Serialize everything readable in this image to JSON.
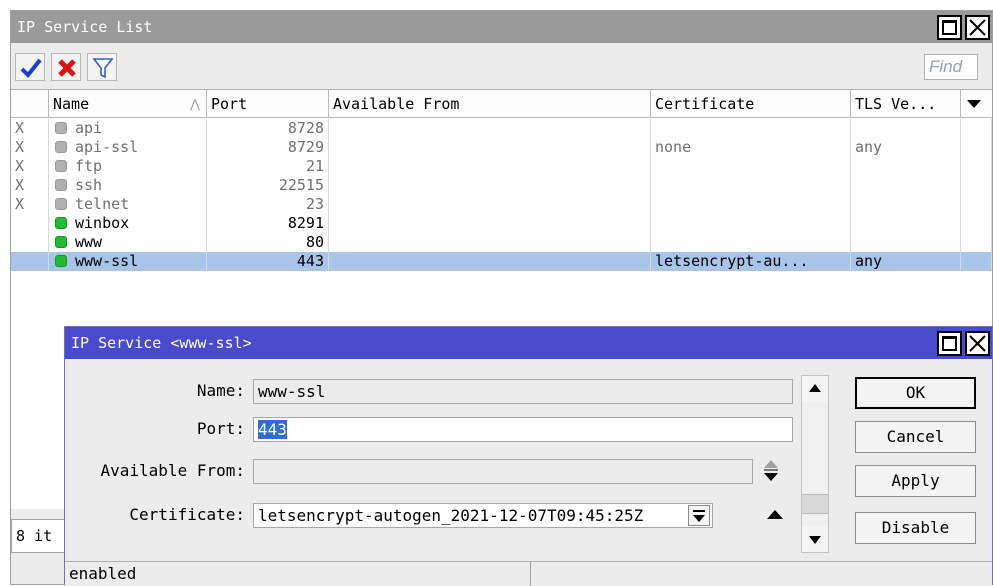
{
  "list_window": {
    "title": "IP Service List",
    "find_placeholder": "Find",
    "columns": [
      "Name",
      "Port",
      "Available From",
      "Certificate",
      "TLS Ve..."
    ],
    "rows": [
      {
        "flag": "X",
        "name": "api",
        "port": "8728",
        "available_from": "",
        "certificate": "",
        "tls": "",
        "status": "disabled"
      },
      {
        "flag": "X",
        "name": "api-ssl",
        "port": "8729",
        "available_from": "",
        "certificate": "none",
        "tls": "any",
        "status": "disabled"
      },
      {
        "flag": "X",
        "name": "ftp",
        "port": "21",
        "available_from": "",
        "certificate": "",
        "tls": "",
        "status": "disabled"
      },
      {
        "flag": "X",
        "name": "ssh",
        "port": "22515",
        "available_from": "",
        "certificate": "",
        "tls": "",
        "status": "disabled"
      },
      {
        "flag": "X",
        "name": "telnet",
        "port": "23",
        "available_from": "",
        "certificate": "",
        "tls": "",
        "status": "disabled"
      },
      {
        "flag": "",
        "name": "winbox",
        "port": "8291",
        "available_from": "",
        "certificate": "",
        "tls": "",
        "status": "enabled"
      },
      {
        "flag": "",
        "name": "www",
        "port": "80",
        "available_from": "",
        "certificate": "",
        "tls": "",
        "status": "enabled"
      },
      {
        "flag": "",
        "name": "www-ssl",
        "port": "443",
        "available_from": "",
        "certificate": "letsencrypt-au...",
        "tls": "any",
        "status": "enabled",
        "selected": true
      }
    ],
    "item_count": "8 it"
  },
  "detail_window": {
    "title": "IP Service <www-ssl>",
    "name_label": "Name:",
    "name_value": "www-ssl",
    "port_label": "Port:",
    "port_value": "443",
    "available_from_label": "Available From:",
    "available_from_value": "",
    "certificate_label": "Certificate:",
    "certificate_value": "letsencrypt-autogen_2021-12-07T09:45:25Z",
    "buttons": {
      "ok": "OK",
      "cancel": "Cancel",
      "apply": "Apply",
      "disable": "Disable"
    },
    "status": "enabled"
  },
  "colors": {
    "list_title_bg": "#9a9a9a",
    "dialog_title_bg": "#4a4acc",
    "selected_row": "#a8c4e8",
    "enabled_led": "#22bb33",
    "disabled_led": "#b0b0b0"
  }
}
